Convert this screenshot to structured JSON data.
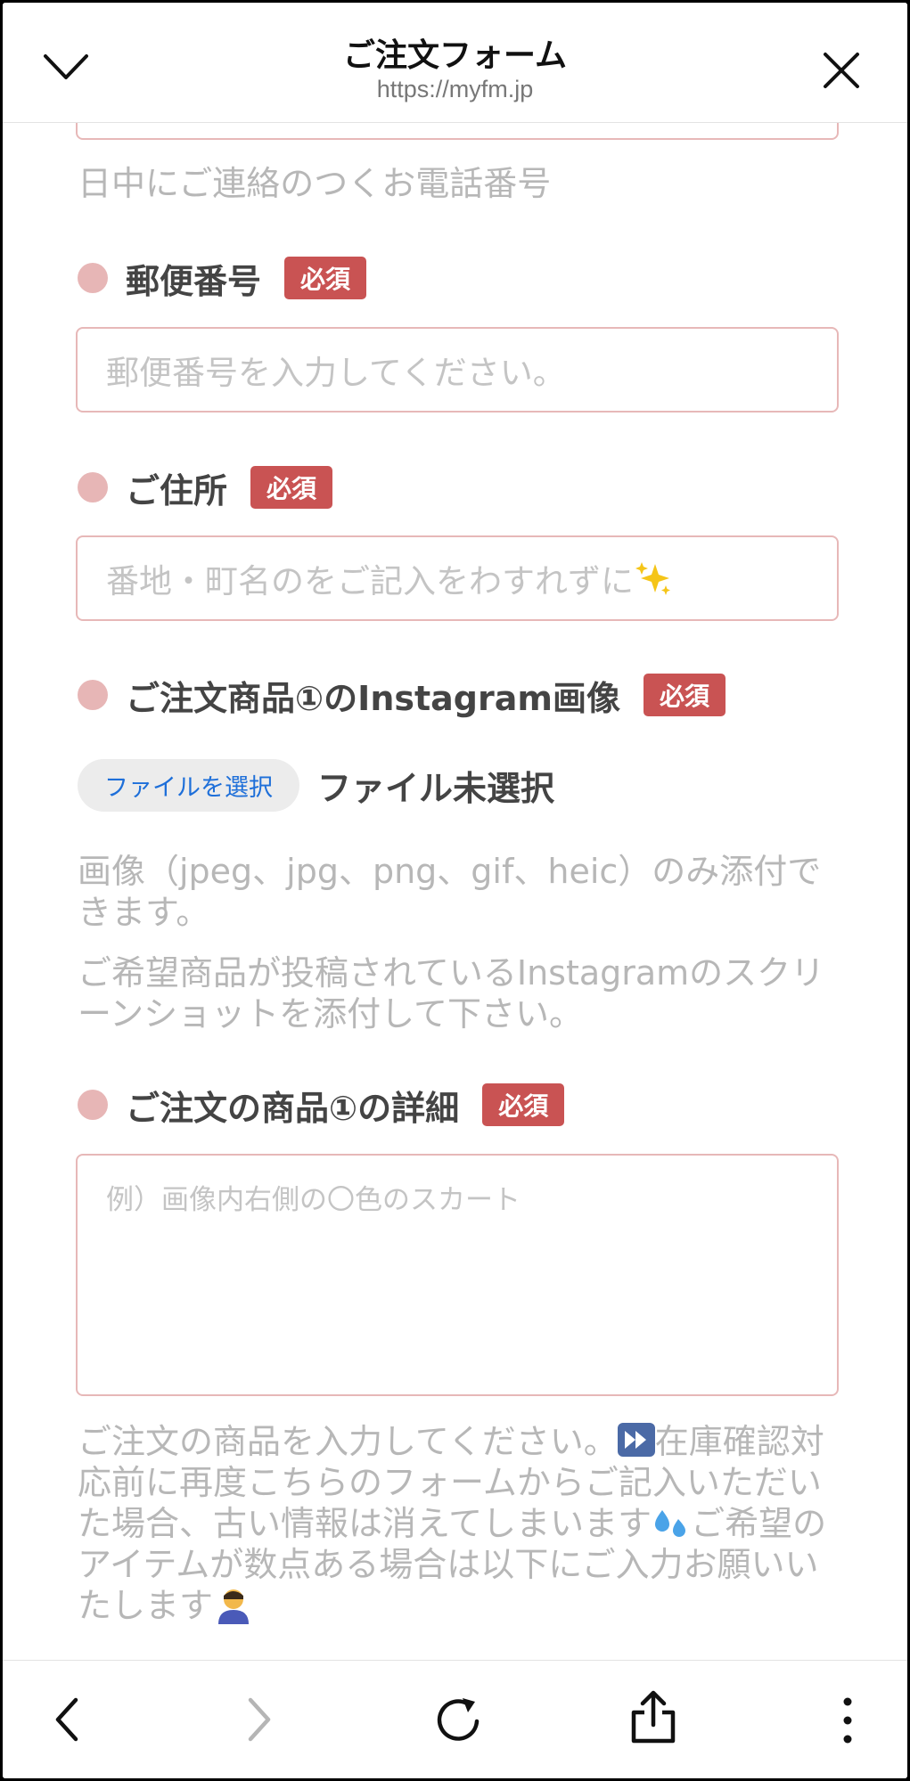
{
  "header": {
    "title": "ご注文フォーム",
    "url": "https://myfm.jp"
  },
  "phone": {
    "help": "日中にご連絡のつくお電話番号"
  },
  "postal": {
    "label": "郵便番号",
    "required": "必須",
    "placeholder": "郵便番号を入力してください。"
  },
  "address": {
    "label": "ご住所",
    "required": "必須",
    "placeholder": "番地・町名のをご記入をわすれずに"
  },
  "image": {
    "label": "ご注文商品①のInstagram画像",
    "required": "必須",
    "file_button": "ファイルを選択",
    "file_status": "ファイル未選択",
    "help1": "画像（jpeg、jpg、png、gif、heic）のみ添付できます。",
    "help2": "ご希望商品が投稿されているInstagramのスクリーンショットを添付して下さい。"
  },
  "details": {
    "label": "ご注文の商品①の詳細",
    "required": "必須",
    "placeholder": "例）画像内右側の〇色のスカート",
    "help_part1": "ご注文の商品を入力してください。",
    "help_part2": "在庫確認対応前に再度こちらのフォームからご記入いただいた場合、古い情報は消えてしまいます",
    "help_part3": "ご希望のアイテムが数点ある場合は以下にご入力お願いいたします"
  },
  "icons": {
    "top_left": "chevron-down-icon",
    "top_right": "close-icon",
    "bottom": [
      "back-arrow-icon",
      "forward-arrow-icon",
      "reload-icon",
      "share-icon",
      "more-vertical-icon"
    ]
  },
  "colors": {
    "accent_dot": "#e7b6b6",
    "required_badge": "#c95353",
    "input_border": "#e7b8b8",
    "file_button_text": "#1e6fd9"
  }
}
